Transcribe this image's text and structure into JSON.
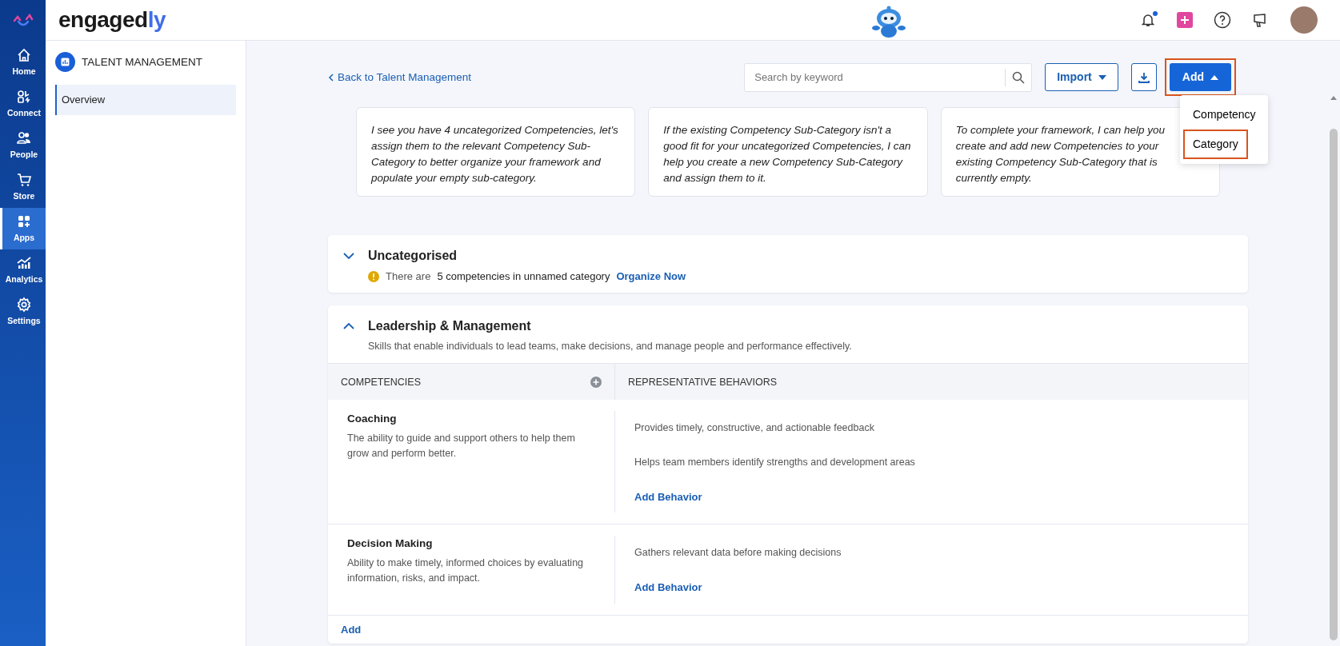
{
  "brand": {
    "name_main": "engaged",
    "name_accent": "ly"
  },
  "rail": [
    {
      "label": "Home",
      "selected": false
    },
    {
      "label": "Connect",
      "selected": false
    },
    {
      "label": "People",
      "selected": false
    },
    {
      "label": "Store",
      "selected": false
    },
    {
      "label": "Apps",
      "selected": true
    },
    {
      "label": "Analytics",
      "selected": false
    },
    {
      "label": "Settings",
      "selected": false
    }
  ],
  "notifications": {
    "unread": true
  },
  "sidebar": {
    "title": "TALENT MANAGEMENT",
    "items": [
      {
        "label": "Overview",
        "selected": true
      }
    ]
  },
  "toolbar": {
    "back_link": "Back to Talent Management",
    "search": {
      "placeholder": "Search by keyword"
    },
    "import_button": "Import",
    "add_button": {
      "label": "Add",
      "expanded": true,
      "highlighted": true
    }
  },
  "add_menu": [
    {
      "label": "Competency",
      "highlighted": false
    },
    {
      "label": "Category",
      "highlighted": true
    }
  ],
  "suggestions": [
    "I see you have 4 uncategorized Competencies, let's assign them to the relevant Competency Sub-Category to better organize your framework and populate your empty sub-category.",
    "If the existing Competency Sub-Category isn't a good fit for your uncategorized Competencies, I can help you create a new Competency Sub-Category and assign them to it.",
    "To complete your framework, I can help you create and add new Competencies to your existing Competency Sub-Category that is currently empty."
  ],
  "categories": [
    {
      "name": "Uncategorised",
      "expanded": false,
      "notice": {
        "prefix": "There are",
        "count_text": "5 competencies in unnamed category",
        "link": "Organize Now"
      }
    },
    {
      "name": "Leadership & Management",
      "expanded": true,
      "description": "Skills that enable individuals to lead teams, make decisions, and manage people and performance effectively.",
      "table": {
        "columns": [
          "COMPETENCIES",
          "REPRESENTATIVE BEHAVIORS"
        ],
        "rows": [
          {
            "name": "Coaching",
            "description": "The ability to guide and support others to help them grow and perform better.",
            "behaviors": [
              "Provides timely, constructive, and actionable feedback",
              "Helps team members identify strengths and development areas"
            ],
            "add_behavior": "Add Behavior"
          },
          {
            "name": "Decision Making",
            "description": "Ability to make timely, informed choices by evaluating information, risks, and impact.",
            "behaviors": [
              "Gathers relevant data before making decisions"
            ],
            "add_behavior": "Add Behavior"
          }
        ]
      },
      "add_link": "Add"
    }
  ]
}
